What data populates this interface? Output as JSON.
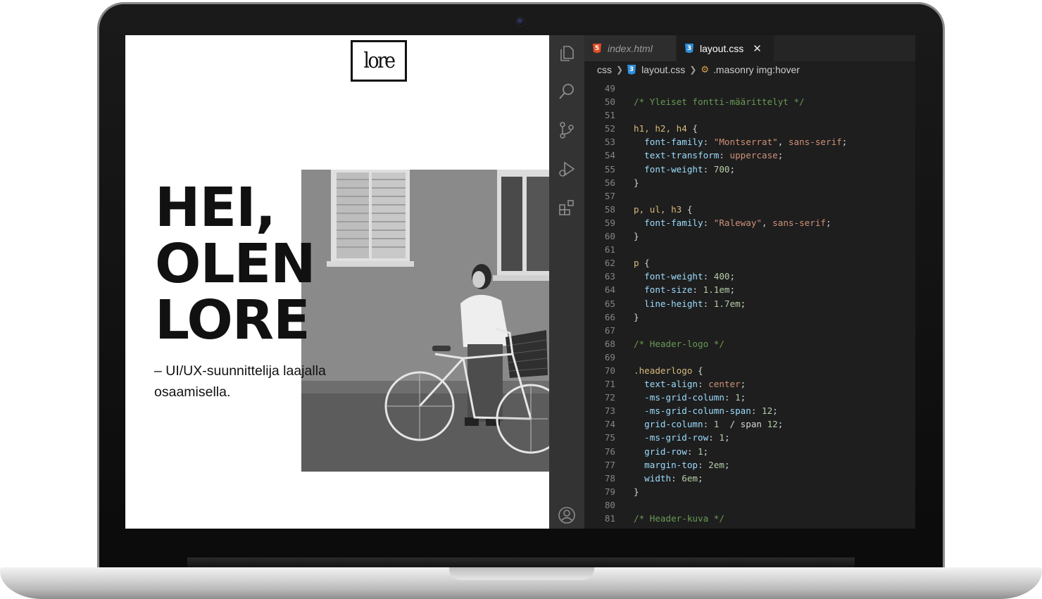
{
  "site": {
    "logo_text": "lore",
    "hero_lines": [
      "HEI,",
      "OLEN",
      "LORE"
    ],
    "subtitle": "– UI/UX-suunnittelija laajalla osaamisella."
  },
  "editor": {
    "tabs": [
      {
        "label": "index.html",
        "badge": "5",
        "active": false
      },
      {
        "label": "layout.css",
        "badge": "3",
        "active": true,
        "close": "✕"
      }
    ],
    "breadcrumb": {
      "folder": "css",
      "file": "layout.css",
      "symbol": ".masonry img:hover"
    },
    "activity_icons": [
      "explorer-icon",
      "search-icon",
      "source-control-icon",
      "run-debug-icon",
      "extensions-icon",
      "account-icon"
    ],
    "lines": [
      {
        "n": "49",
        "tokens": []
      },
      {
        "n": "50",
        "tokens": [
          [
            "c-com",
            "/* Yleiset fontti-määrittelyt */"
          ]
        ]
      },
      {
        "n": "51",
        "tokens": []
      },
      {
        "n": "52",
        "tokens": [
          [
            "c-sel",
            "h1, h2, h4"
          ],
          [
            "c-pun",
            " {"
          ]
        ]
      },
      {
        "n": "53",
        "tokens": [
          [
            "c-pun",
            "  "
          ],
          [
            "c-prop",
            "font-family"
          ],
          [
            "c-pun",
            ": "
          ],
          [
            "c-str",
            "\"Montserrat\""
          ],
          [
            "c-pun",
            ", "
          ],
          [
            "c-str",
            "sans-serif"
          ],
          [
            "c-pun",
            ";"
          ]
        ]
      },
      {
        "n": "54",
        "tokens": [
          [
            "c-pun",
            "  "
          ],
          [
            "c-prop",
            "text-transform"
          ],
          [
            "c-pun",
            ": "
          ],
          [
            "c-str",
            "uppercase"
          ],
          [
            "c-pun",
            ";"
          ]
        ]
      },
      {
        "n": "55",
        "tokens": [
          [
            "c-pun",
            "  "
          ],
          [
            "c-prop",
            "font-weight"
          ],
          [
            "c-pun",
            ": "
          ],
          [
            "c-num",
            "700"
          ],
          [
            "c-pun",
            ";"
          ]
        ]
      },
      {
        "n": "56",
        "tokens": [
          [
            "c-pun",
            "}"
          ]
        ]
      },
      {
        "n": "57",
        "tokens": []
      },
      {
        "n": "58",
        "tokens": [
          [
            "c-sel",
            "p, ul, h3"
          ],
          [
            "c-pun",
            " {"
          ]
        ]
      },
      {
        "n": "59",
        "tokens": [
          [
            "c-pun",
            "  "
          ],
          [
            "c-prop",
            "font-family"
          ],
          [
            "c-pun",
            ": "
          ],
          [
            "c-str",
            "\"Raleway\""
          ],
          [
            "c-pun",
            ", "
          ],
          [
            "c-str",
            "sans-serif"
          ],
          [
            "c-pun",
            ";"
          ]
        ]
      },
      {
        "n": "60",
        "tokens": [
          [
            "c-pun",
            "}"
          ]
        ]
      },
      {
        "n": "61",
        "tokens": []
      },
      {
        "n": "62",
        "tokens": [
          [
            "c-sel",
            "p"
          ],
          [
            "c-pun",
            " {"
          ]
        ]
      },
      {
        "n": "63",
        "tokens": [
          [
            "c-pun",
            "  "
          ],
          [
            "c-prop",
            "font-weight"
          ],
          [
            "c-pun",
            ": "
          ],
          [
            "c-num",
            "400"
          ],
          [
            "c-pun",
            ";"
          ]
        ]
      },
      {
        "n": "64",
        "tokens": [
          [
            "c-pun",
            "  "
          ],
          [
            "c-prop",
            "font-size"
          ],
          [
            "c-pun",
            ": "
          ],
          [
            "c-num",
            "1.1em"
          ],
          [
            "c-pun",
            ";"
          ]
        ]
      },
      {
        "n": "65",
        "tokens": [
          [
            "c-pun",
            "  "
          ],
          [
            "c-prop",
            "line-height"
          ],
          [
            "c-pun",
            ": "
          ],
          [
            "c-num",
            "1.7em"
          ],
          [
            "c-pun",
            ";"
          ]
        ]
      },
      {
        "n": "66",
        "tokens": [
          [
            "c-pun",
            "}"
          ]
        ]
      },
      {
        "n": "67",
        "tokens": []
      },
      {
        "n": "68",
        "tokens": [
          [
            "c-com",
            "/* Header-logo */"
          ]
        ]
      },
      {
        "n": "69",
        "tokens": []
      },
      {
        "n": "70",
        "tokens": [
          [
            "c-sel",
            ".headerlogo"
          ],
          [
            "c-pun",
            " {"
          ]
        ]
      },
      {
        "n": "71",
        "tokens": [
          [
            "c-pun",
            "  "
          ],
          [
            "c-prop",
            "text-align"
          ],
          [
            "c-pun",
            ": "
          ],
          [
            "c-str",
            "center"
          ],
          [
            "c-pun",
            ";"
          ]
        ]
      },
      {
        "n": "72",
        "tokens": [
          [
            "c-pun",
            "  "
          ],
          [
            "c-prop",
            "-ms-grid-column"
          ],
          [
            "c-pun",
            ": "
          ],
          [
            "c-num",
            "1"
          ],
          [
            "c-pun",
            ";"
          ]
        ]
      },
      {
        "n": "73",
        "tokens": [
          [
            "c-pun",
            "  "
          ],
          [
            "c-prop",
            "-ms-grid-column-span"
          ],
          [
            "c-pun",
            ": "
          ],
          [
            "c-num",
            "12"
          ],
          [
            "c-pun",
            ";"
          ]
        ]
      },
      {
        "n": "74",
        "tokens": [
          [
            "c-pun",
            "  "
          ],
          [
            "c-prop",
            "grid-column"
          ],
          [
            "c-pun",
            ": "
          ],
          [
            "c-num",
            "1"
          ],
          [
            "c-pun",
            "  / span "
          ],
          [
            "c-num",
            "12"
          ],
          [
            "c-pun",
            ";"
          ]
        ]
      },
      {
        "n": "75",
        "tokens": [
          [
            "c-pun",
            "  "
          ],
          [
            "c-prop",
            "-ms-grid-row"
          ],
          [
            "c-pun",
            ": "
          ],
          [
            "c-num",
            "1"
          ],
          [
            "c-pun",
            ";"
          ]
        ]
      },
      {
        "n": "76",
        "tokens": [
          [
            "c-pun",
            "  "
          ],
          [
            "c-prop",
            "grid-row"
          ],
          [
            "c-pun",
            ": "
          ],
          [
            "c-num",
            "1"
          ],
          [
            "c-pun",
            ";"
          ]
        ]
      },
      {
        "n": "77",
        "tokens": [
          [
            "c-pun",
            "  "
          ],
          [
            "c-prop",
            "margin-top"
          ],
          [
            "c-pun",
            ": "
          ],
          [
            "c-num",
            "2em"
          ],
          [
            "c-pun",
            ";"
          ]
        ]
      },
      {
        "n": "78",
        "tokens": [
          [
            "c-pun",
            "  "
          ],
          [
            "c-prop",
            "width"
          ],
          [
            "c-pun",
            ": "
          ],
          [
            "c-num",
            "6em"
          ],
          [
            "c-pun",
            ";"
          ]
        ]
      },
      {
        "n": "79",
        "tokens": [
          [
            "c-pun",
            "}"
          ]
        ]
      },
      {
        "n": "80",
        "tokens": []
      },
      {
        "n": "81",
        "tokens": [
          [
            "c-com",
            "/* Header-kuva */"
          ]
        ]
      }
    ]
  },
  "colors": {
    "editor_bg": "#1e1e1e",
    "activity_bar": "#333333",
    "comment": "#6a9955",
    "selector": "#d7ba7d",
    "property": "#9cdcfe",
    "string": "#ce9178",
    "number": "#b5cea8"
  }
}
